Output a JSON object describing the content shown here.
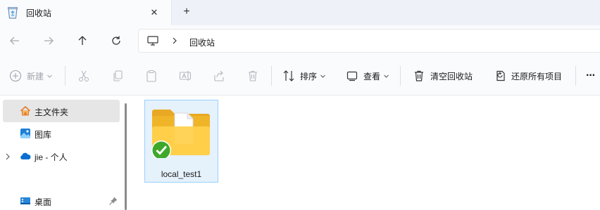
{
  "tab": {
    "title": "回收站",
    "icon": "recycle-bin-icon",
    "close_glyph": "✕"
  },
  "new_tab_glyph": "+",
  "address": {
    "icon": "this-pc-icon",
    "crumbs": [
      "回收站"
    ]
  },
  "toolbar": {
    "new_label": "新建",
    "sort_label": "排序",
    "view_label": "查看",
    "empty_bin_label": "清空回收站",
    "restore_all_label": "还原所有项目",
    "more_glyph": "···"
  },
  "sidebar": {
    "items": [
      {
        "label": "主文件夹",
        "icon": "home-icon",
        "selected": true
      },
      {
        "label": "图库",
        "icon": "gallery-icon"
      },
      {
        "label": "jie - 个人",
        "icon": "onedrive-icon",
        "expandable": true
      },
      {
        "label": "桌面",
        "icon": "desktop-icon",
        "pinned": true
      }
    ]
  },
  "files": [
    {
      "name": "local_test1",
      "icon": "folder-synced-icon",
      "selected": true
    }
  ],
  "colors": {
    "accent": "#0067c0",
    "selection": "#e5f1fb",
    "selection_border": "#99d1ff"
  }
}
